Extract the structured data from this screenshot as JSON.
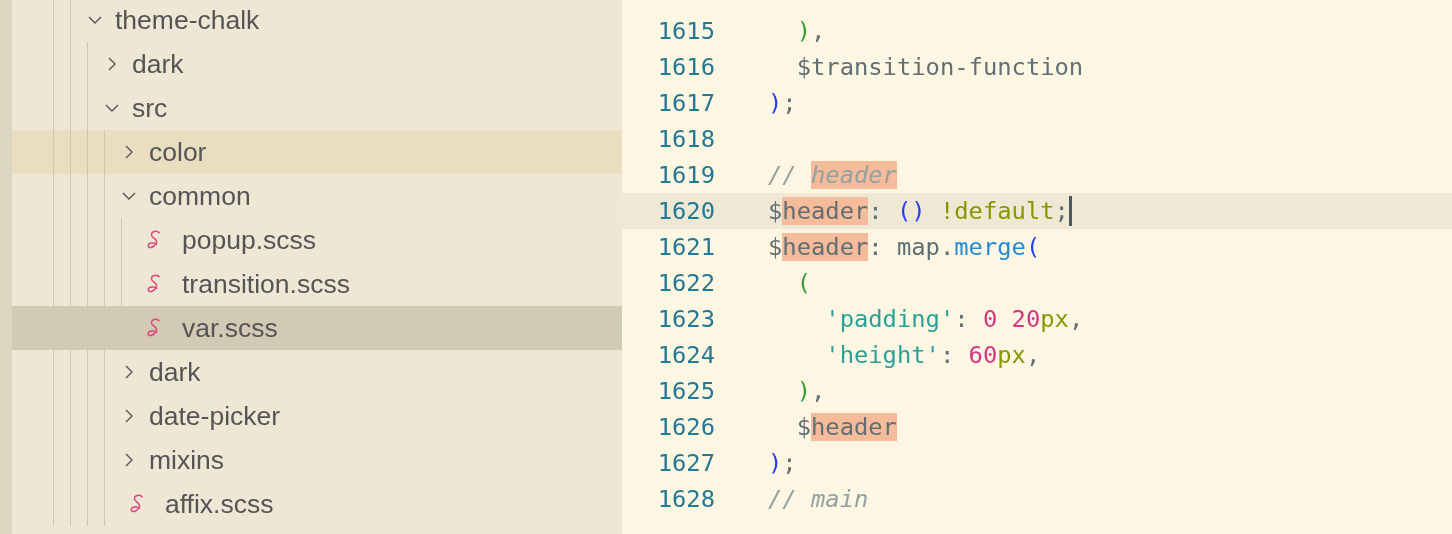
{
  "explorer": {
    "items": [
      {
        "label": "theme-chalk",
        "kind": "folder",
        "expanded": true,
        "selected": false,
        "hovered": false,
        "children": [
          {
            "label": "dark",
            "kind": "folder",
            "expanded": false,
            "selected": false,
            "hovered": false
          },
          {
            "label": "src",
            "kind": "folder",
            "expanded": true,
            "selected": false,
            "hovered": false,
            "children": [
              {
                "label": "color",
                "kind": "folder",
                "expanded": false,
                "selected": false,
                "hovered": true
              },
              {
                "label": "common",
                "kind": "folder",
                "expanded": true,
                "selected": false,
                "hovered": false,
                "children": [
                  {
                    "label": "popup.scss",
                    "kind": "file",
                    "selected": false,
                    "hovered": false
                  },
                  {
                    "label": "transition.scss",
                    "kind": "file",
                    "selected": false,
                    "hovered": false
                  },
                  {
                    "label": "var.scss",
                    "kind": "file",
                    "selected": true,
                    "hovered": false
                  }
                ]
              },
              {
                "label": "dark",
                "kind": "folder",
                "expanded": false,
                "selected": false,
                "hovered": false
              },
              {
                "label": "date-picker",
                "kind": "folder",
                "expanded": false,
                "selected": false,
                "hovered": false
              },
              {
                "label": "mixins",
                "kind": "folder",
                "expanded": false,
                "selected": false,
                "hovered": false
              },
              {
                "label": "affix.scss",
                "kind": "file",
                "selected": false,
                "hovered": false
              }
            ]
          }
        ]
      }
    ]
  },
  "editor": {
    "lines": [
      {
        "number": "1615",
        "current": false,
        "tokens": [
          {
            "text": "  )",
            "kind": "bracket2",
            "match": false
          },
          {
            "text": ",",
            "kind": "plain",
            "match": false
          }
        ]
      },
      {
        "number": "1616",
        "current": false,
        "tokens": [
          {
            "text": "  $transition-function",
            "kind": "variable",
            "match": false
          }
        ]
      },
      {
        "number": "1617",
        "current": false,
        "tokens": [
          {
            "text": ")",
            "kind": "bracket1",
            "match": false
          },
          {
            "text": ";",
            "kind": "plain",
            "match": false
          }
        ]
      },
      {
        "number": "1618",
        "current": false
      },
      {
        "number": "1619",
        "current": false,
        "tokens": [
          {
            "text": "// ",
            "kind": "comment",
            "match": false
          },
          {
            "text": "header",
            "kind": "comment",
            "match": true
          }
        ]
      },
      {
        "number": "1620",
        "current": true,
        "tokens": [
          {
            "text": "$",
            "kind": "variable",
            "match": false
          },
          {
            "text": "header",
            "kind": "variable",
            "match": true
          },
          {
            "text": ": ",
            "kind": "plain",
            "match": false
          },
          {
            "text": "()",
            "kind": "bracket1",
            "match": false
          },
          {
            "text": " !default",
            "kind": "keyword",
            "match": false
          },
          {
            "text": ";",
            "kind": "plain",
            "match": false
          }
        ]
      },
      {
        "number": "1621",
        "current": false,
        "tokens": [
          {
            "text": "$",
            "kind": "variable",
            "match": false
          },
          {
            "text": "header",
            "kind": "variable",
            "match": true
          },
          {
            "text": ": map.",
            "kind": "plain",
            "match": false
          },
          {
            "text": "merge",
            "kind": "function",
            "match": false
          },
          {
            "text": "(",
            "kind": "bracket1",
            "match": false
          }
        ]
      },
      {
        "number": "1622",
        "current": false,
        "tokens": [
          {
            "text": "  (",
            "kind": "bracket2",
            "match": false
          }
        ]
      },
      {
        "number": "1623",
        "current": false,
        "tokens": [
          {
            "text": "    'padding'",
            "kind": "string",
            "match": false
          },
          {
            "text": ": ",
            "kind": "plain",
            "match": false
          },
          {
            "text": "0 20",
            "kind": "number",
            "match": false
          },
          {
            "text": "px",
            "kind": "unit",
            "match": false
          },
          {
            "text": ",",
            "kind": "plain",
            "match": false
          }
        ]
      },
      {
        "number": "1624",
        "current": false,
        "tokens": [
          {
            "text": "    'height'",
            "kind": "string",
            "match": false
          },
          {
            "text": ": ",
            "kind": "plain",
            "match": false
          },
          {
            "text": "60",
            "kind": "number",
            "match": false
          },
          {
            "text": "px",
            "kind": "unit",
            "match": false
          },
          {
            "text": ",",
            "kind": "plain",
            "match": false
          }
        ]
      },
      {
        "number": "1625",
        "current": false,
        "tokens": [
          {
            "text": "  )",
            "kind": "bracket2",
            "match": false
          },
          {
            "text": ",",
            "kind": "plain",
            "match": false
          }
        ]
      },
      {
        "number": "1626",
        "current": false,
        "tokens": [
          {
            "text": "  $",
            "kind": "variable",
            "match": false
          },
          {
            "text": "header",
            "kind": "variable",
            "match": true
          }
        ]
      },
      {
        "number": "1627",
        "current": false,
        "tokens": [
          {
            "text": ")",
            "kind": "bracket1",
            "match": false
          },
          {
            "text": ";",
            "kind": "plain",
            "match": false
          }
        ]
      },
      {
        "number": "1628",
        "current": false,
        "tokens": [
          {
            "text": "// main",
            "kind": "comment",
            "match": false
          }
        ]
      }
    ]
  }
}
